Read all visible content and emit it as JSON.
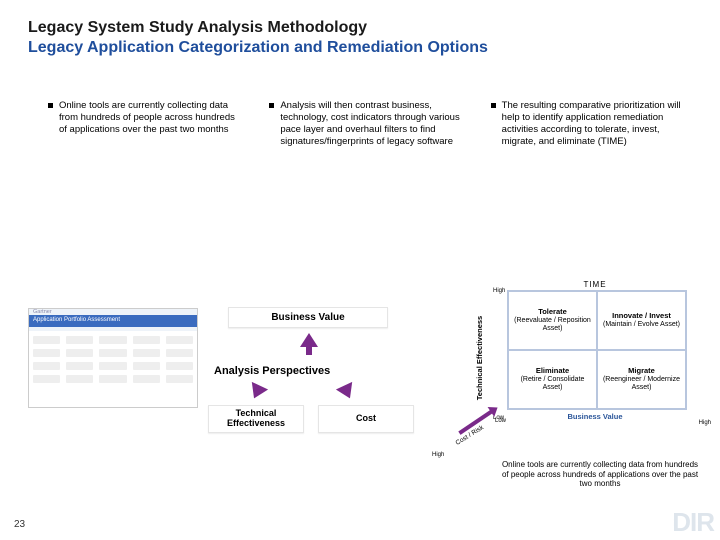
{
  "title": {
    "line1": "Legacy System Study Analysis Methodology",
    "line2": "Legacy Application Categorization and Remediation Options"
  },
  "bullets": [
    "Online tools are currently collecting data from hundreds of people across hundreds of applications over the past two months",
    "Analysis will then contrast business, technology, cost indicators through various pace layer and overhaul filters to find signatures/fingerprints of legacy software",
    "The resulting comparative prioritization will help to identify application remediation activities according to tolerate, invest, migrate, and eliminate (TIME)"
  ],
  "thumbnail": {
    "vendor": "Gartner",
    "heading": "Application Portfolio Assessment"
  },
  "perspectives": {
    "business_value": "Business Value",
    "title": "Analysis Perspectives",
    "technical": "Technical\nEffectiveness",
    "cost": "Cost"
  },
  "time": {
    "title": "TIME",
    "y_axis": "Technical Effectiveness",
    "x_axis": "Business Value",
    "high": "High",
    "low": "Low",
    "quadrants": [
      {
        "name": "Tolerate",
        "sub": "(Reevaluate / Reposition Asset)"
      },
      {
        "name": "Innovate / Invest",
        "sub": "(Maintain / Evolve Asset)"
      },
      {
        "name": "Eliminate",
        "sub": "(Retire / Consolidate Asset)"
      },
      {
        "name": "Migrate",
        "sub": "(Reengineer / Modernize Asset)"
      }
    ],
    "cost_risk": "Cost / Risk"
  },
  "footnote": "Online tools are currently collecting data from hundreds of people across hundreds of applications over the past two months",
  "page_number": "23"
}
